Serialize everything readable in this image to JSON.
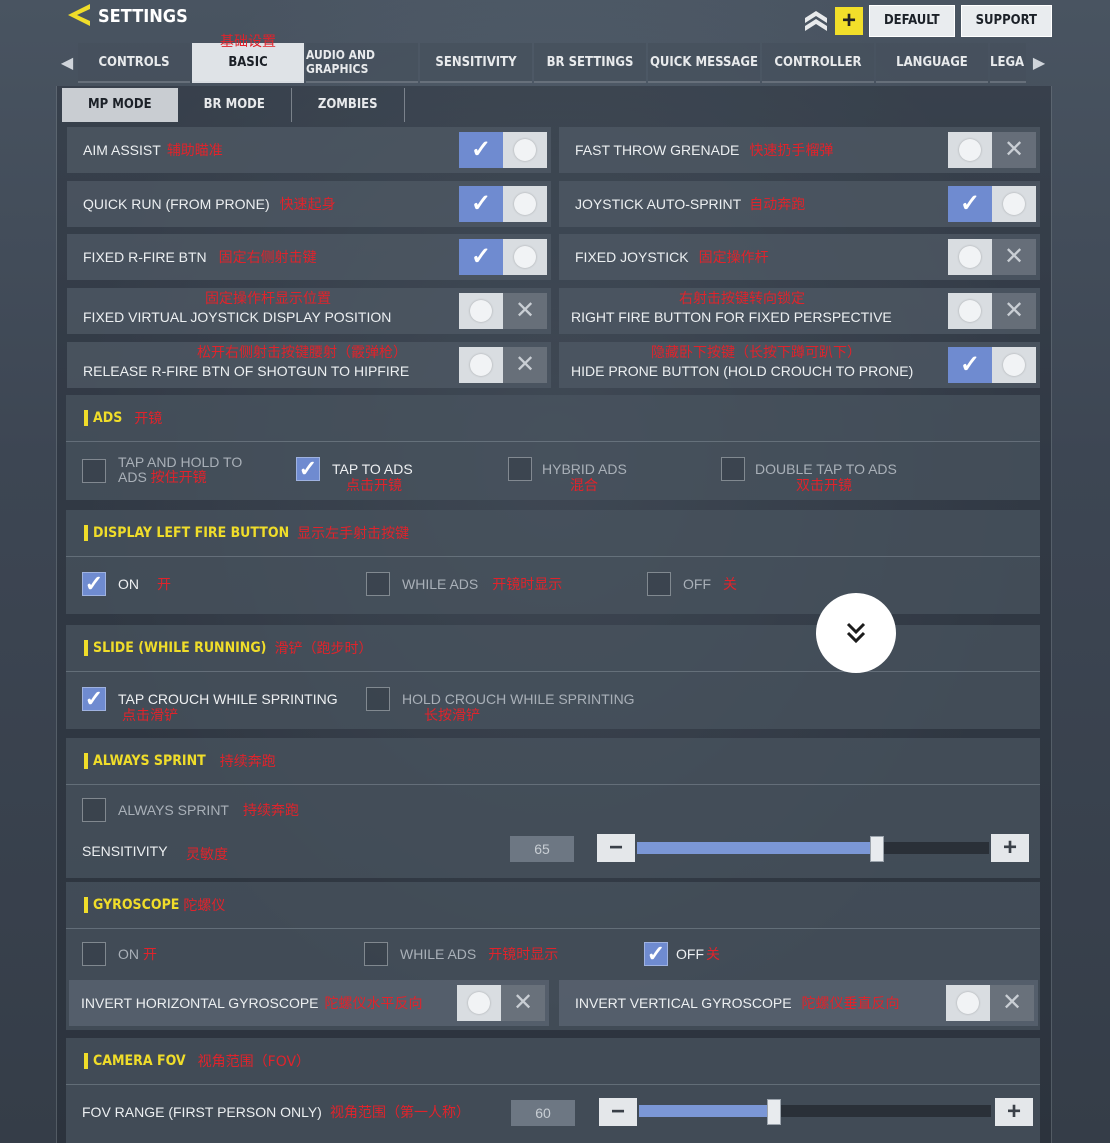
{
  "header": {
    "title": "SETTINGS",
    "default_label": "DEFAULT",
    "support_label": "SUPPORT",
    "plus_label": "+",
    "icons": {
      "back": "back-arrow-icon",
      "rank": "rank-chevron-icon"
    }
  },
  "tabs": [
    {
      "label": "CONTROLS"
    },
    {
      "label": "BASIC",
      "annotation": "基础设置",
      "active": true
    },
    {
      "label": "AUDIO AND GRAPHICS"
    },
    {
      "label": "SENSITIVITY"
    },
    {
      "label": "BR SETTINGS"
    },
    {
      "label": "QUICK MESSAGE"
    },
    {
      "label": "CONTROLLER"
    },
    {
      "label": "LANGUAGE"
    },
    {
      "label": "LEGA"
    }
  ],
  "modes": [
    "MP MODE",
    "BR MODE",
    "ZOMBIES"
  ],
  "toggles": {
    "aim_assist": {
      "label": "AIM ASSIST",
      "annotation": "辅助瞄准",
      "on": true
    },
    "fast_throw": {
      "label": "FAST THROW GRENADE",
      "annotation": "快速扔手榴弹",
      "on": false
    },
    "quick_run": {
      "label": "QUICK RUN (FROM PRONE)",
      "annotation": "快速起身",
      "on": true
    },
    "joystick_sprint": {
      "label": "JOYSTICK AUTO-SPRINT",
      "annotation": "自动奔跑",
      "on": true
    },
    "fixed_rfire": {
      "label": "FIXED R-FIRE BTN",
      "annotation": "固定右侧射击键",
      "on": true
    },
    "fixed_joystick": {
      "label": "FIXED JOYSTICK",
      "annotation": "固定操作杆",
      "on": false
    },
    "fixed_virtual": {
      "label": "FIXED VIRTUAL JOYSTICK DISPLAY POSITION",
      "annotation": "固定操作杆显示位置",
      "on": false
    },
    "right_fire": {
      "label": "RIGHT FIRE BUTTON FOR FIXED PERSPECTIVE",
      "annotation": "右射击按键转向锁定",
      "on": false
    },
    "release_rfire": {
      "label": "RELEASE R-FIRE BTN OF SHOTGUN TO HIPFIRE",
      "annotation": "松开右侧射击按键腰射（霰弹枪）",
      "on": false
    },
    "hide_prone": {
      "label": "HIDE PRONE BUTTON (HOLD CROUCH TO PRONE)",
      "annotation": "隐藏卧下按键（长按下蹲可趴下）",
      "on": true
    },
    "invert_h": {
      "label": "INVERT HORIZONTAL GYROSCOPE",
      "annotation": "陀螺仪水平反向",
      "on": false
    },
    "invert_v": {
      "label": "INVERT VERTICAL GYROSCOPE",
      "annotation": "陀螺仪垂直反向",
      "on": false
    }
  },
  "ads": {
    "title": "ADS",
    "annotation": "开镜",
    "options": [
      {
        "line1": "TAP AND HOLD TO",
        "line2": "ADS",
        "annotation": "按住开镜",
        "checked": false
      },
      {
        "label": "TAP TO ADS",
        "annotation": "点击开镜",
        "checked": true
      },
      {
        "label": "HYBRID ADS",
        "annotation": "混合",
        "checked": false
      },
      {
        "label": "DOUBLE TAP TO ADS",
        "annotation": "双击开镜",
        "checked": false
      }
    ]
  },
  "left_fire": {
    "title": "DISPLAY LEFT FIRE BUTTON",
    "annotation": "显示左手射击按键",
    "options": [
      {
        "label": "ON",
        "annotation": "开",
        "checked": true
      },
      {
        "label": "WHILE ADS",
        "annotation": "开镜时显示",
        "checked": false
      },
      {
        "label": "OFF",
        "annotation": "关",
        "checked": false
      }
    ]
  },
  "slide": {
    "title": "SLIDE (WHILE RUNNING)",
    "annotation": "滑铲（跑步时）",
    "options": [
      {
        "label": "TAP CROUCH WHILE SPRINTING",
        "annotation": "点击滑铲",
        "checked": true
      },
      {
        "label": "HOLD CROUCH WHILE SPRINTING",
        "annotation": "长按滑铲",
        "checked": false
      }
    ]
  },
  "always_sprint": {
    "title": "ALWAYS SPRINT",
    "annotation": "持续奔跑",
    "option": {
      "label": "ALWAYS SPRINT",
      "annotation": "持续奔跑",
      "checked": false
    },
    "sensitivity": {
      "label": "SENSITIVITY",
      "annotation": "灵敏度",
      "value": "65",
      "fraction": 0.68,
      "minus": "−",
      "plus": "+"
    }
  },
  "gyroscope": {
    "title": "GYROSCOPE",
    "annotation": "陀螺仪",
    "options": [
      {
        "label": "ON",
        "annotation": "开",
        "checked": false
      },
      {
        "label": "WHILE ADS",
        "annotation": "开镜时显示",
        "checked": false
      },
      {
        "label": "OFF",
        "annotation": "关",
        "checked": true
      }
    ]
  },
  "camera_fov": {
    "title": "CAMERA FOV",
    "annotation": "视角范围（FOV）",
    "fov": {
      "label": "FOV RANGE (FIRST PERSON ONLY)",
      "annotation": "视角范围（第一人称）",
      "value": "60",
      "fraction": 0.38,
      "minus": "−",
      "plus": "+"
    }
  },
  "scroll_icon": "double-chevron-down-icon"
}
